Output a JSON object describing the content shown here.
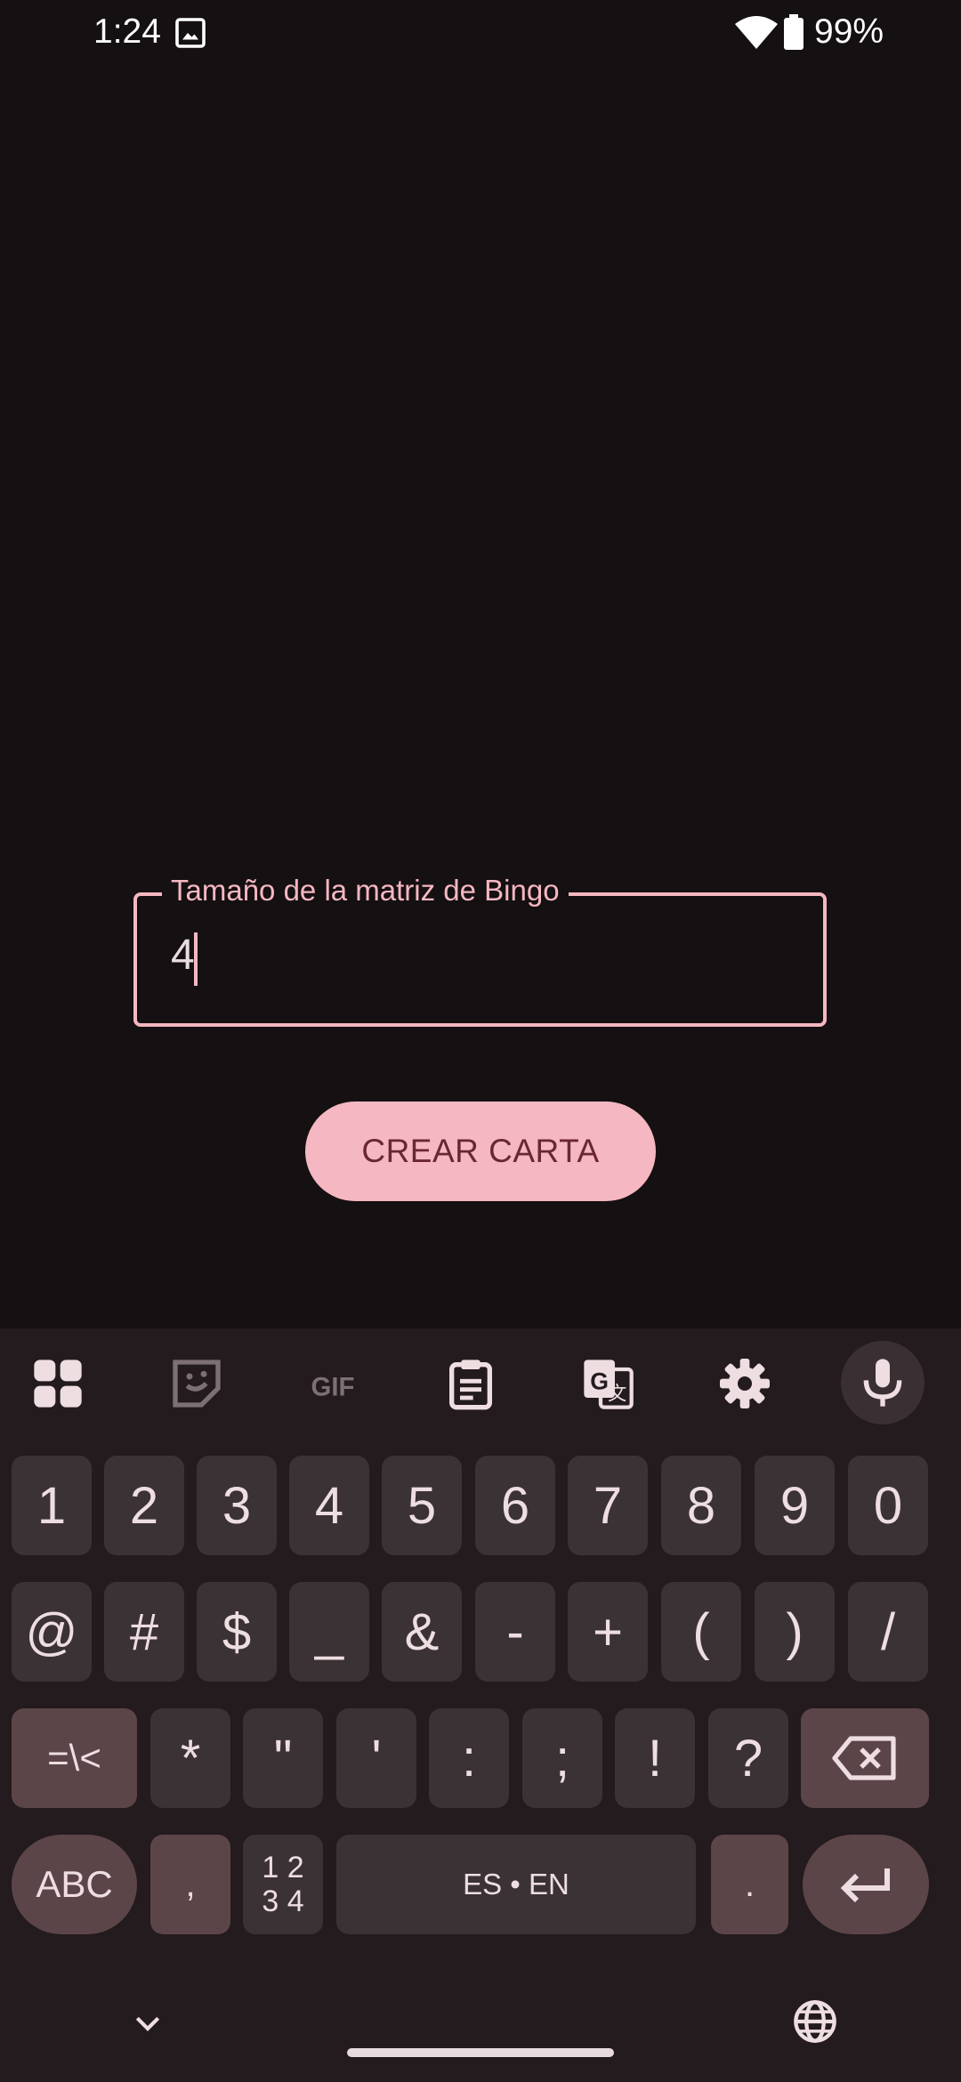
{
  "status_bar": {
    "time": "1:24",
    "battery": "99%"
  },
  "form": {
    "field_label": "Tamaño de la matriz de Bingo",
    "field_value": "4",
    "button_label": "CREAR CARTA"
  },
  "keyboard": {
    "toolbar_icons": [
      "apps-grid-icon",
      "sticker-icon",
      "gif-icon",
      "clipboard-icon",
      "translate-icon",
      "settings-gear-icon",
      "microphone-icon"
    ],
    "row1": [
      "1",
      "2",
      "3",
      "4",
      "5",
      "6",
      "7",
      "8",
      "9",
      "0"
    ],
    "row2": [
      "@",
      "#",
      "$",
      "_",
      "&",
      "-",
      "+",
      "(",
      ")",
      "/"
    ],
    "row3": [
      "=\\<",
      "*",
      "\"",
      "'",
      ":",
      ";",
      "!",
      "?"
    ],
    "row4": {
      "abc": "ABC",
      "comma": ",",
      "numpad_top": "1 2",
      "numpad_bottom": "3 4",
      "space": "ES • EN",
      "period": "."
    },
    "colors": {
      "background": "#231b1e",
      "key": "#3a3234",
      "accent_key": "#5c4548",
      "primary": "#f5b7c1"
    }
  }
}
